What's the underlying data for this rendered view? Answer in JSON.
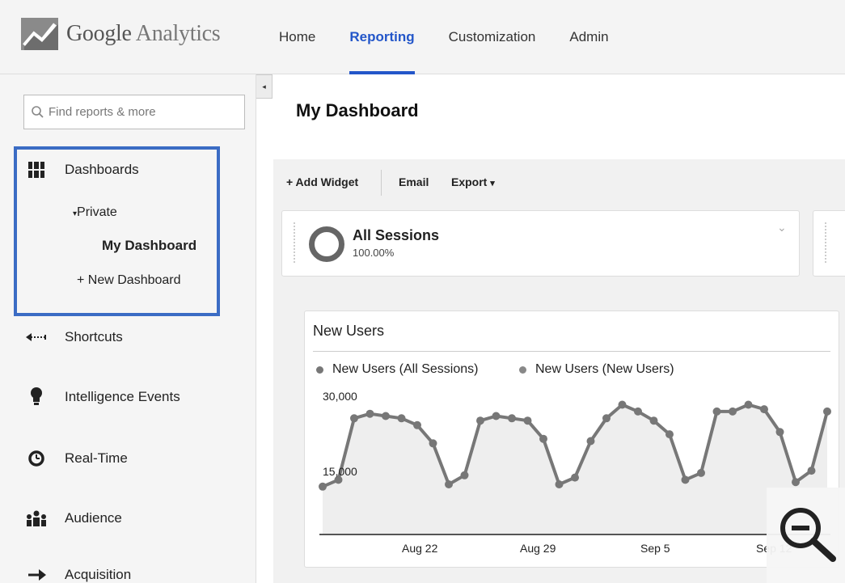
{
  "app": {
    "logo_brand": "Google",
    "logo_product": "Analytics"
  },
  "nav": {
    "items": [
      {
        "label": "Home",
        "active": false
      },
      {
        "label": "Reporting",
        "active": true
      },
      {
        "label": "Customization",
        "active": false
      },
      {
        "label": "Admin",
        "active": false
      }
    ]
  },
  "sidebar": {
    "collapse_glyph": "◂",
    "search_placeholder": "Find reports & more",
    "dashboards": {
      "label": "Dashboards",
      "private_label": "Private",
      "my_dashboard": "My Dashboard",
      "new_dashboard": "+ New Dashboard"
    },
    "items": [
      {
        "label": "Shortcuts",
        "icon": "arrow-left-icon"
      },
      {
        "label": "Intelligence Events",
        "icon": "lightbulb-icon"
      },
      {
        "label": "Real-Time",
        "icon": "clock-icon"
      },
      {
        "label": "Audience",
        "icon": "people-icon"
      },
      {
        "label": "Acquisition",
        "icon": "arrow-right-icon"
      }
    ],
    "highlight_color": "#3b6cc4"
  },
  "main": {
    "page_title": "My Dashboard",
    "toolbar": {
      "add_widget": "+ Add Widget",
      "email": "Email",
      "export": "Export",
      "export_caret": "▾"
    },
    "segment": {
      "name": "All Sessions",
      "percent": "100.00%",
      "chevron": "⌄"
    }
  },
  "widget": {
    "title": "New Users",
    "legend": [
      {
        "label": "New Users (All Sessions)",
        "color": "#777777"
      },
      {
        "label": "New Users (New Users)",
        "color": "#888888"
      }
    ]
  },
  "chart_data": {
    "type": "line",
    "title": "New Users",
    "series": [
      {
        "name": "New Users (All Sessions)",
        "values": [
          10500,
          12000,
          25500,
          26500,
          26000,
          25500,
          24000,
          20000,
          11000,
          13000,
          25000,
          26000,
          25500,
          25000,
          21000,
          11000,
          12500,
          20500,
          25500,
          28500,
          27000,
          25000,
          22000,
          12000,
          13500,
          27000,
          27000,
          28500,
          27500,
          22500,
          11500,
          14000,
          27000
        ]
      }
    ],
    "x_tick_labels": [
      "Aug 22",
      "Aug 29",
      "Sep 5",
      "Sep 12"
    ],
    "y_tick_labels": [
      "30,000",
      "15,000"
    ],
    "ylim": [
      0,
      30000
    ],
    "color": "#777777",
    "area_fill": true
  },
  "colors": {
    "accent": "#2356c9",
    "series": "#777777"
  }
}
